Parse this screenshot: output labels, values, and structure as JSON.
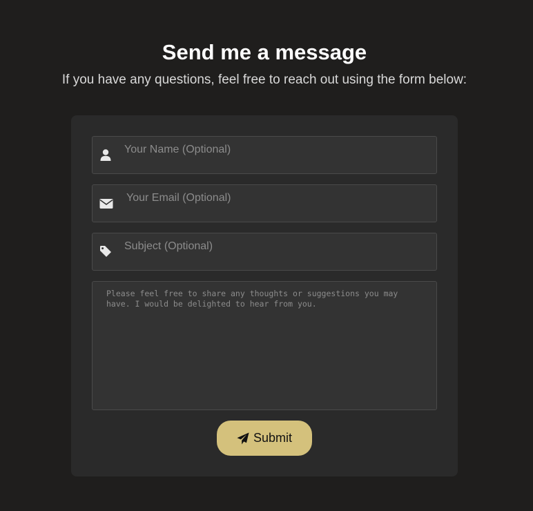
{
  "header": {
    "title": "Send me a message",
    "subtitle": "If you have any questions, feel free to reach out using the form below:"
  },
  "form": {
    "name": {
      "placeholder": "Your Name (Optional)",
      "value": "",
      "icon": "user-icon"
    },
    "email": {
      "placeholder": "Your Email (Optional)",
      "value": "",
      "icon": "envelope-icon"
    },
    "subject": {
      "placeholder": "Subject (Optional)",
      "value": "",
      "icon": "tag-icon"
    },
    "message": {
      "placeholder": "Please feel free to share any thoughts or suggestions you may have. I would be delighted to hear from you.",
      "value": ""
    },
    "submit": {
      "label": "Submit",
      "icon": "paper-plane-icon"
    }
  },
  "colors": {
    "background": "#1f1e1d",
    "card": "#2a2a2a",
    "field": "#333333",
    "accent": "#d4c17c"
  }
}
